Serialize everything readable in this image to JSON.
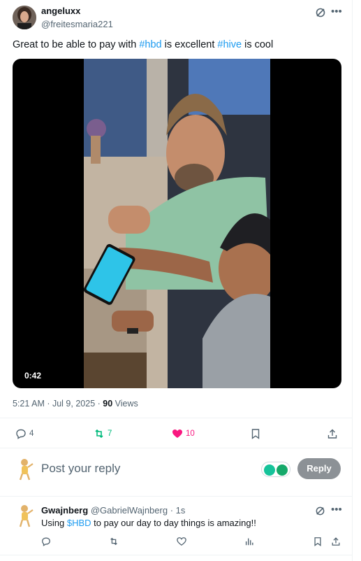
{
  "tweet": {
    "author": {
      "name": "angeluxx",
      "handle": "@freitesmaria221"
    },
    "text": {
      "part1": "Great to be able to pay with ",
      "tag1": "#hbd",
      "part2": " is excellent ",
      "tag2": "#hive",
      "part3": " is cool"
    },
    "media": {
      "duration": "0:42"
    },
    "meta": {
      "time": "5:21 AM",
      "sep": " · ",
      "date": "Jul 9, 2025",
      "sep2": " · ",
      "views_count": "90",
      "views_label": " Views"
    },
    "actions": {
      "replies": "4",
      "reposts": "7",
      "likes": "10"
    }
  },
  "composer": {
    "placeholder": "Post your reply",
    "button_label": "Reply"
  },
  "reply": {
    "author": {
      "name": "Gwajnberg",
      "handle": "@GabrielWajnberg",
      "time": " · 1s"
    },
    "text": {
      "part1": "Using ",
      "cashtag": "$HBD",
      "part2": " to pay our day to day things is amazing!!"
    }
  },
  "colors": {
    "accent": "#1d9bf0",
    "repost": "#00ba7c",
    "like": "#f91880",
    "muted": "#536471"
  },
  "icons": [
    "grok-icon",
    "more-icon",
    "reply-icon",
    "repost-icon",
    "heart-icon",
    "bookmark-icon",
    "share-icon",
    "views-icon",
    "grammarly-icon"
  ]
}
